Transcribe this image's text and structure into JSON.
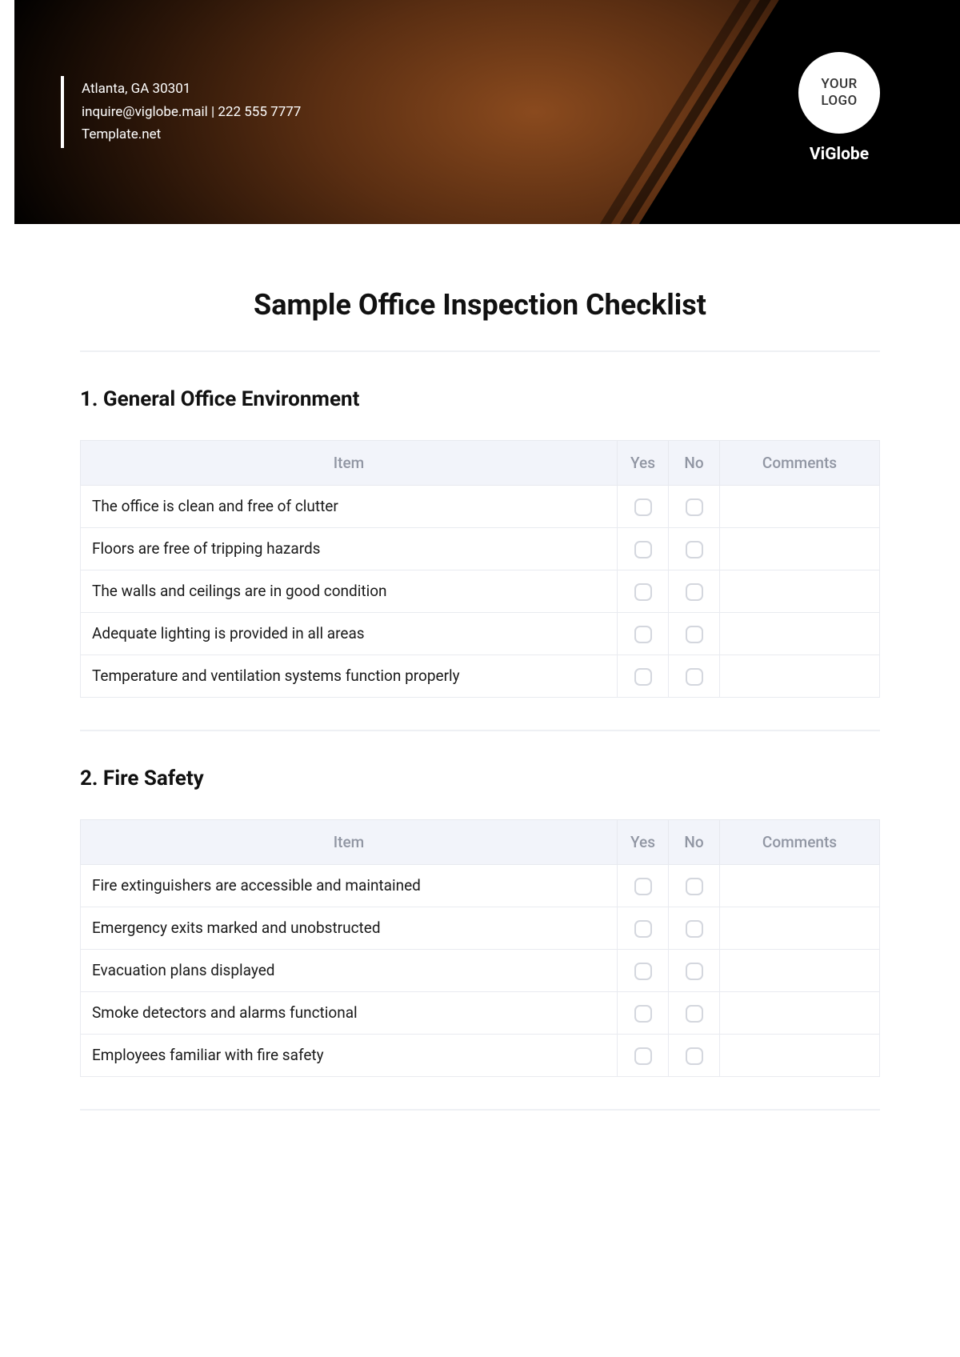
{
  "header": {
    "address": "Atlanta, GA 30301",
    "email": "inquire@viglobe.mail",
    "separator": "  |  ",
    "phone": "222 555 7777",
    "template": "Template.net",
    "logo_line1": "YOUR",
    "logo_line2": "LOGO",
    "brand": "ViGlobe"
  },
  "page": {
    "title": "Sample Office Inspection Checklist"
  },
  "columns": {
    "item": "Item",
    "yes": "Yes",
    "no": "No",
    "comments": "Comments"
  },
  "sections": [
    {
      "title": "1. General Office Environment",
      "items": [
        "The office is clean and free of clutter",
        "Floors are free of tripping hazards",
        "The walls and ceilings are in good condition",
        "Adequate lighting is provided in all areas",
        "Temperature and ventilation systems function properly"
      ]
    },
    {
      "title": "2. Fire Safety",
      "items": [
        "Fire extinguishers are accessible and maintained",
        "Emergency exits marked and unobstructed",
        "Evacuation plans displayed",
        "Smoke detectors and alarms functional",
        "Employees familiar with fire safety"
      ]
    }
  ]
}
